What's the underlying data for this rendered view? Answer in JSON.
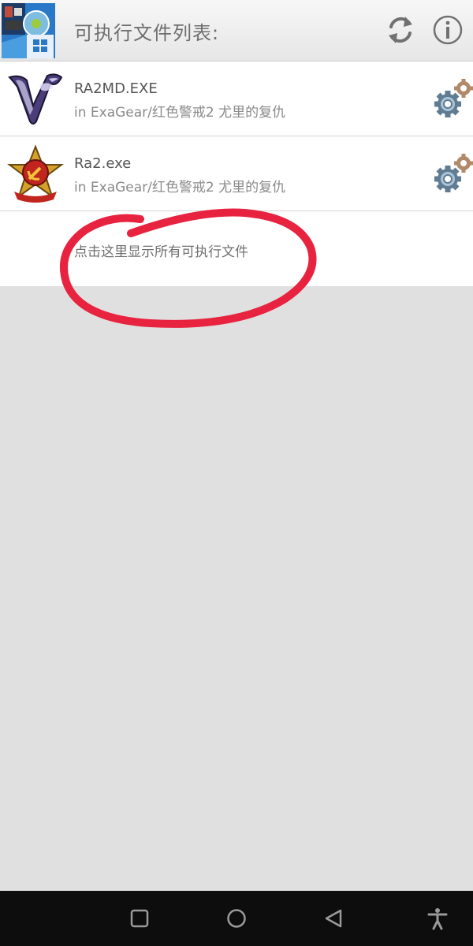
{
  "header": {
    "title": "可执行文件列表:",
    "app_icon": "exagear-app-icon",
    "refresh_icon": "refresh-icon",
    "info_icon": "info-icon"
  },
  "files": [
    {
      "name": "RA2MD.EXE",
      "path": "in ExaGear/红色警戒2 尤里的复仇",
      "icon": "yuri-logo-icon"
    },
    {
      "name": "Ra2.exe",
      "path": "in ExaGear/红色警戒2 尤里的复仇",
      "icon": "soviet-emblem-icon"
    }
  ],
  "show_all_label": "点击这里显示所有可执行文件",
  "colors": {
    "annotation": "#e8233f",
    "background": "#e0e0e0",
    "list_background": "#ffffff"
  },
  "navbar": {
    "recent_icon": "square-icon",
    "home_icon": "circle-icon",
    "back_icon": "triangle-back-icon",
    "accessibility_icon": "accessibility-icon"
  }
}
